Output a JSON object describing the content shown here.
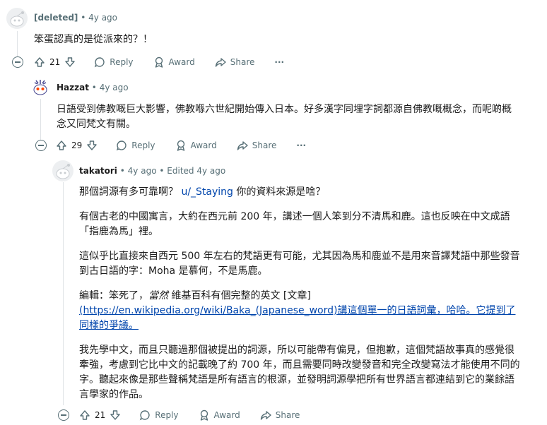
{
  "comments": [
    {
      "username": "[deleted]",
      "age": "4y ago",
      "body": [
        "笨蛋認真的是從派來的？！"
      ],
      "votes": "21"
    },
    {
      "username": "Hazzat",
      "age": "4y ago",
      "body": [
        "日語受到佛教嘅巨大影響，佛教喺六世紀開始傳入日本。好多漢字同埋字詞都源自佛教嘅概念，而呢啲概念又同梵文有關。"
      ],
      "votes": "29"
    },
    {
      "username": "takatori",
      "age": "4y ago",
      "edited": "Edited 4y ago",
      "votes": "21",
      "p1_before": "那個詞源有多可靠啊？ ",
      "p1_mention": "u/_Staying",
      "p1_after": " 你的資料來源是啥？",
      "p2": "有個古老的中國寓言，大約在西元前 200 年，講述一個人笨到分不清馬和鹿。這也反映在中文成語「指鹿為馬」裡。",
      "p3": "這似乎比直接來自西元 500 年左右的梵語更有可能，尤其因為馬和鹿並不是用來音譯梵語中那些發音到古日語的字：Moha 是慕何，不是馬鹿。",
      "p4_a": "編輯：笨死了，",
      "p4_em": "當然",
      "p4_b": " 維基百科有個完整的英文 [文章]",
      "p4_link": "(https://en.wikipedia.org/wiki/Baka_(Japanese_word)講這個單一的日語詞彙，哈哈。它提到了同樣的爭議。",
      "p5": "我先學中文，而且只聽過那個被提出的詞源，所以可能帶有偏見，但抱歉，這個梵語故事真的感覺很牽強，考慮到它比中文的記載晚了約 700 年，而且需要同時改變發音和完全改變寫法才能使用不同的字。聽起來像是那些聲稱梵語是所有語言的根源，並發明詞源學把所有世界語言都連結到它的業餘語言學家的作品。"
    }
  ],
  "actions": {
    "reply": "Reply",
    "award": "Award",
    "share": "Share",
    "more": "···",
    "separator": "•"
  },
  "colors": {
    "meta": "#576f76",
    "link": "#0045ac",
    "thread": "#dfe3e6"
  }
}
